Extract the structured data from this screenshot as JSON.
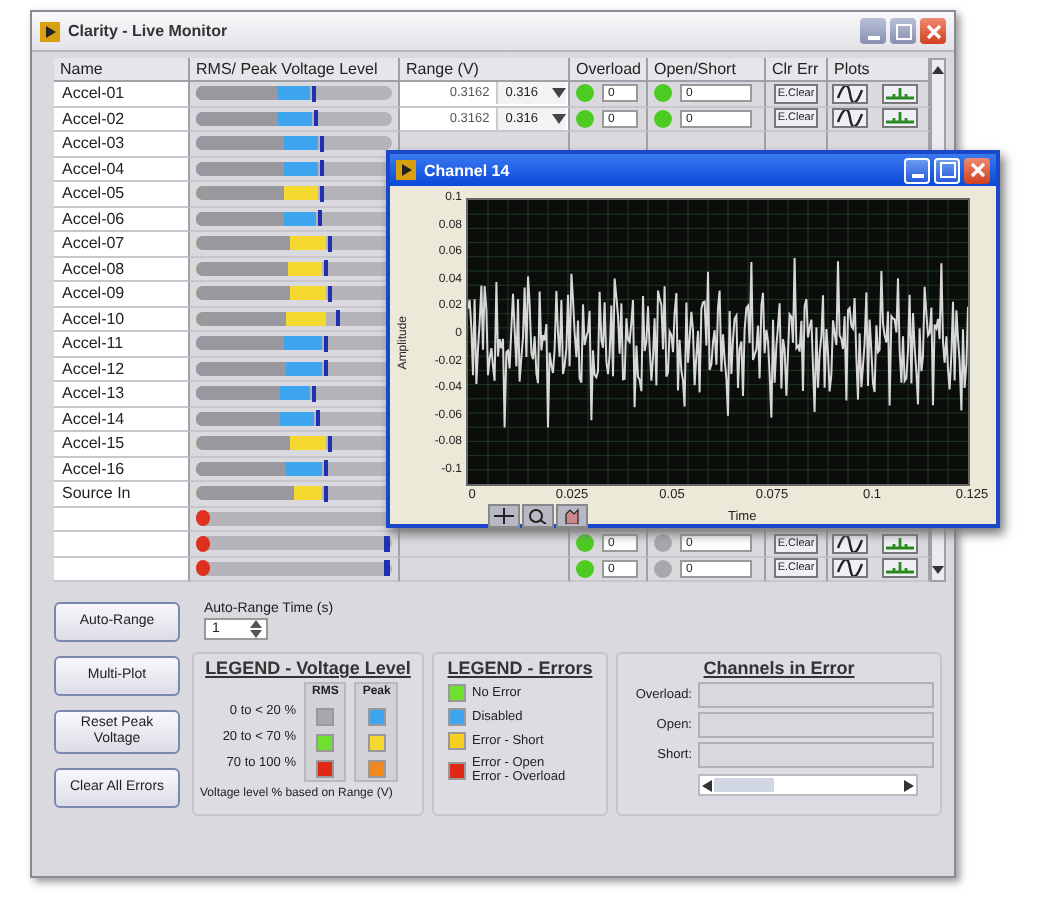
{
  "window": {
    "title": "Clarity - Live Monitor"
  },
  "table": {
    "columns": [
      "Name",
      "RMS/ Peak Voltage Level",
      "Range (V)",
      "Overload",
      "Open/Short",
      "Clr Err",
      "Plots"
    ],
    "rows": [
      {
        "name": "Accel-01",
        "rms": {
          "level": 0.42
        },
        "peak": {
          "level": 0.58,
          "color": "#3ea6f0"
        },
        "hold": {
          "level": 0.6
        },
        "range": "0.3162",
        "range_select": "0.316",
        "overload": {
          "color": "#4ccc20",
          "count": "0"
        },
        "open_short": {
          "color": "#4ccc20",
          "count": "0"
        },
        "clear": "E.Clear"
      },
      {
        "name": "Accel-02",
        "rms": {
          "level": 0.42
        },
        "peak": {
          "level": 0.59,
          "color": "#3ea6f0"
        },
        "hold": {
          "level": 0.61
        },
        "range": "0.3162",
        "range_select": "0.316",
        "overload": {
          "color": "#4ccc20",
          "count": "0"
        },
        "open_short": {
          "color": "#4ccc20",
          "count": "0"
        },
        "clear": "E.Clear"
      },
      {
        "name": "Accel-03",
        "rms": {
          "level": 0.45
        },
        "peak": {
          "level": 0.62,
          "color": "#3ea6f0"
        },
        "hold": {
          "level": 0.64
        }
      },
      {
        "name": "Accel-04",
        "rms": {
          "level": 0.45
        },
        "peak": {
          "level": 0.62,
          "color": "#3ea6f0"
        },
        "hold": {
          "level": 0.64
        }
      },
      {
        "name": "Accel-05",
        "rms": {
          "level": 0.45
        },
        "peak": {
          "level": 0.62,
          "color": "#f5d830"
        },
        "hold": {
          "level": 0.64
        }
      },
      {
        "name": "Accel-06",
        "rms": {
          "level": 0.45
        },
        "peak": {
          "level": 0.61,
          "color": "#3ea6f0"
        },
        "hold": {
          "level": 0.63
        }
      },
      {
        "name": "Accel-07",
        "rms": {
          "level": 0.48
        },
        "peak": {
          "level": 0.66,
          "color": "#f5d830"
        },
        "hold": {
          "level": 0.68
        }
      },
      {
        "name": "Accel-08",
        "rms": {
          "level": 0.47
        },
        "peak": {
          "level": 0.64,
          "color": "#f5d830"
        },
        "hold": {
          "level": 0.66
        }
      },
      {
        "name": "Accel-09",
        "rms": {
          "level": 0.48
        },
        "peak": {
          "level": 0.66,
          "color": "#f5d830"
        },
        "hold": {
          "level": 0.68
        }
      },
      {
        "name": "Accel-10",
        "rms": {
          "level": 0.46
        },
        "peak": {
          "level": 0.66,
          "color": "#f5d830"
        },
        "hold": {
          "level": 0.72
        }
      },
      {
        "name": "Accel-11",
        "rms": {
          "level": 0.45
        },
        "peak": {
          "level": 0.64,
          "color": "#3ea6f0"
        },
        "hold": {
          "level": 0.66
        }
      },
      {
        "name": "Accel-12",
        "rms": {
          "level": 0.46
        },
        "peak": {
          "level": 0.64,
          "color": "#3ea6f0"
        },
        "hold": {
          "level": 0.66
        }
      },
      {
        "name": "Accel-13",
        "rms": {
          "level": 0.43
        },
        "peak": {
          "level": 0.58,
          "color": "#3ea6f0"
        },
        "hold": {
          "level": 0.6
        }
      },
      {
        "name": "Accel-14",
        "rms": {
          "level": 0.43
        },
        "peak": {
          "level": 0.6,
          "color": "#3ea6f0"
        },
        "hold": {
          "level": 0.62
        }
      },
      {
        "name": "Accel-15",
        "rms": {
          "level": 0.48
        },
        "peak": {
          "level": 0.66,
          "color": "#f5d830"
        },
        "hold": {
          "level": 0.68
        }
      },
      {
        "name": "Accel-16",
        "rms": {
          "level": 0.46
        },
        "peak": {
          "level": 0.64,
          "color": "#3ea6f0"
        },
        "hold": {
          "level": 0.66
        }
      },
      {
        "name": "Source In",
        "rms": {
          "level": 0.5
        },
        "peak": {
          "level": 0.64,
          "color": "#f5d830"
        },
        "hold": {
          "level": 0.66
        }
      },
      {
        "fault": true
      },
      {
        "fault": true,
        "hold": {
          "level": 0.97
        },
        "overload": {
          "color": "#4ccc20",
          "count": "0"
        },
        "open_short": {
          "color": "#a8a8ac",
          "count": "0"
        },
        "clear": "E.Clear"
      },
      {
        "fault": true,
        "hold": {
          "level": 0.97
        },
        "overload": {
          "color": "#4ccc20",
          "count": "0"
        },
        "open_short": {
          "color": "#a8a8ac",
          "count": "0"
        },
        "clear": "E.Clear"
      }
    ]
  },
  "controls": {
    "buttons": [
      "Auto-Range",
      "Multi-Plot",
      "Reset Peak Voltage",
      "Clear All Errors"
    ],
    "auto_range_time": {
      "label": "Auto-Range Time (s)",
      "value": "1"
    }
  },
  "legend_voltage": {
    "title": "LEGEND - Voltage Level",
    "columns": [
      "RMS",
      "Peak"
    ],
    "rows": [
      {
        "label": "0 to < 20 %",
        "swatches": [
          {
            "color": "#a8a8ac"
          },
          {
            "color": "#3ea6f0"
          }
        ]
      },
      {
        "label": "20 to < 70 %",
        "swatches": [
          {
            "color": "#70e030"
          },
          {
            "color": "#f5d830"
          }
        ]
      },
      {
        "label": "70 to 100 %",
        "swatches": [
          {
            "color": "#e02818"
          },
          {
            "color": "#f08a20"
          }
        ]
      }
    ],
    "note": "Voltage level % based on Range (V)"
  },
  "legend_errors": {
    "title": "LEGEND - Errors",
    "items": [
      {
        "lines": [
          "No Error"
        ],
        "color": "#70e030"
      },
      {
        "lines": [
          "Disabled"
        ],
        "color": "#3ea6f0"
      },
      {
        "lines": [
          "Error - Short"
        ],
        "color": "#f5d020"
      },
      {
        "lines": [
          "Error - Open",
          "Error - Overload"
        ],
        "color": "#e02818"
      }
    ]
  },
  "channels_in_error": {
    "title": "Channels in Error",
    "fields": [
      {
        "label": "Overload:"
      },
      {
        "label": "Open:"
      },
      {
        "label": "Short:"
      }
    ]
  },
  "popup": {
    "title": "Channel 14",
    "plot": {
      "ylabel": "Amplitude",
      "xlabel": "Time",
      "yticks": [
        "0.1",
        "0.08",
        "0.06",
        "0.04",
        "0.02",
        "0",
        "-0.02",
        "-0.04",
        "-0.06",
        "-0.08",
        "-0.1"
      ],
      "xticks": [
        "0",
        "0.025",
        "0.05",
        "0.075",
        "0.1",
        "0.125"
      ]
    }
  }
}
